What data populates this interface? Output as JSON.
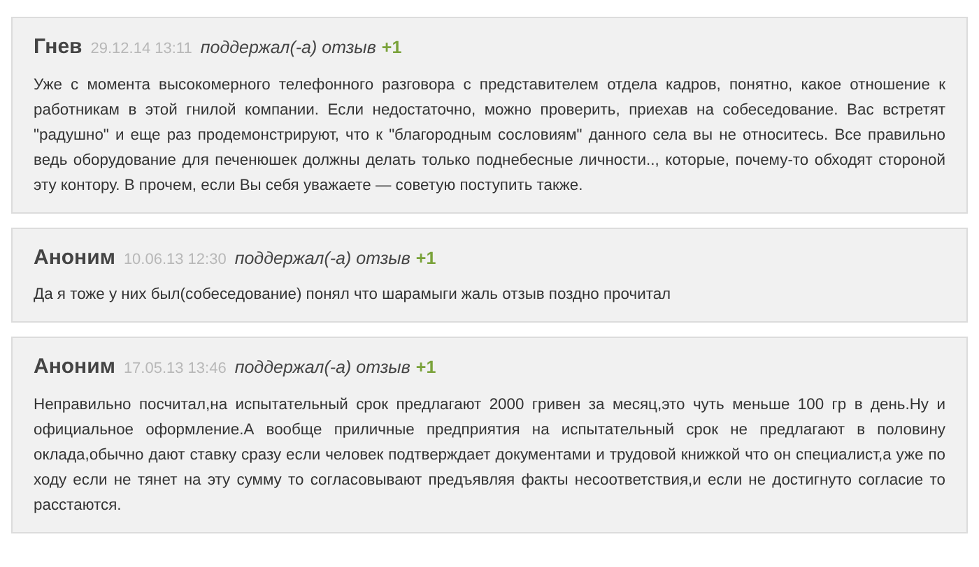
{
  "reviews": [
    {
      "author": "Гнев",
      "date": "29.12.14 13:11",
      "action": "поддержал(-а) отзыв",
      "score": "+1",
      "text": "Уже с момента высокомерного телефонного разговора с представителем отдела кадров, понятно, какое отношение к работникам в этой гнилой компании. Если недостаточно, можно проверить, приехав на собеседование. Вас встретят \"радушно\" и еще раз продемонстрируют, что к \"благородным сословиям\" данного села вы не относитесь. Все правильно ведь оборудование для печенюшек должны делать только поднебесные личности.., которые, почему-то обходят стороной эту контору. В прочем, если Вы себя уважаете — советую поступить также."
    },
    {
      "author": "Аноним",
      "date": "10.06.13 12:30",
      "action": "поддержал(-а) отзыв",
      "score": "+1",
      "text": "Да я тоже у них был(собеседование) понял что шарамыги жаль отзыв поздно прочитал"
    },
    {
      "author": "Аноним",
      "date": "17.05.13 13:46",
      "action": "поддержал(-а) отзыв",
      "score": "+1",
      "text": "Неправильно посчитал,на испытательный срок предлагают 2000 гривен за месяц,это чуть меньше 100 гр в день.Ну и официальное оформление.А вообще приличные предприятия на испытательный срок не предлагают в половину оклада,обычно дают ставку сразу если человек подтверждает документами и трудовой книжкой что он специалист,а уже по ходу если не тянет на эту сумму то согласовывают предъявляя факты несоответствия,и если не достигнуто согласие то расстаются."
    }
  ]
}
